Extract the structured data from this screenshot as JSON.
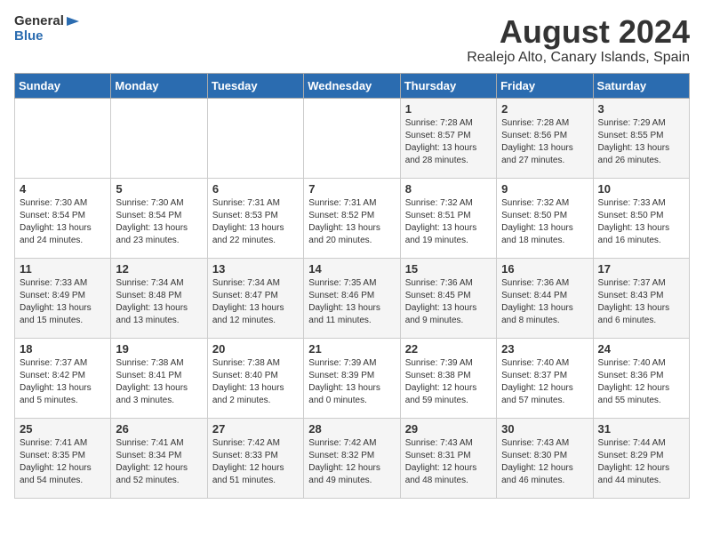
{
  "logo": {
    "general": "General",
    "blue": "Blue"
  },
  "title": {
    "month": "August 2024",
    "location": "Realejo Alto, Canary Islands, Spain"
  },
  "days_of_week": [
    "Sunday",
    "Monday",
    "Tuesday",
    "Wednesday",
    "Thursday",
    "Friday",
    "Saturday"
  ],
  "weeks": [
    [
      {
        "day": "",
        "info": ""
      },
      {
        "day": "",
        "info": ""
      },
      {
        "day": "",
        "info": ""
      },
      {
        "day": "",
        "info": ""
      },
      {
        "day": "1",
        "info": "Sunrise: 7:28 AM\nSunset: 8:57 PM\nDaylight: 13 hours\nand 28 minutes."
      },
      {
        "day": "2",
        "info": "Sunrise: 7:28 AM\nSunset: 8:56 PM\nDaylight: 13 hours\nand 27 minutes."
      },
      {
        "day": "3",
        "info": "Sunrise: 7:29 AM\nSunset: 8:55 PM\nDaylight: 13 hours\nand 26 minutes."
      }
    ],
    [
      {
        "day": "4",
        "info": "Sunrise: 7:30 AM\nSunset: 8:54 PM\nDaylight: 13 hours\nand 24 minutes."
      },
      {
        "day": "5",
        "info": "Sunrise: 7:30 AM\nSunset: 8:54 PM\nDaylight: 13 hours\nand 23 minutes."
      },
      {
        "day": "6",
        "info": "Sunrise: 7:31 AM\nSunset: 8:53 PM\nDaylight: 13 hours\nand 22 minutes."
      },
      {
        "day": "7",
        "info": "Sunrise: 7:31 AM\nSunset: 8:52 PM\nDaylight: 13 hours\nand 20 minutes."
      },
      {
        "day": "8",
        "info": "Sunrise: 7:32 AM\nSunset: 8:51 PM\nDaylight: 13 hours\nand 19 minutes."
      },
      {
        "day": "9",
        "info": "Sunrise: 7:32 AM\nSunset: 8:50 PM\nDaylight: 13 hours\nand 18 minutes."
      },
      {
        "day": "10",
        "info": "Sunrise: 7:33 AM\nSunset: 8:50 PM\nDaylight: 13 hours\nand 16 minutes."
      }
    ],
    [
      {
        "day": "11",
        "info": "Sunrise: 7:33 AM\nSunset: 8:49 PM\nDaylight: 13 hours\nand 15 minutes."
      },
      {
        "day": "12",
        "info": "Sunrise: 7:34 AM\nSunset: 8:48 PM\nDaylight: 13 hours\nand 13 minutes."
      },
      {
        "day": "13",
        "info": "Sunrise: 7:34 AM\nSunset: 8:47 PM\nDaylight: 13 hours\nand 12 minutes."
      },
      {
        "day": "14",
        "info": "Sunrise: 7:35 AM\nSunset: 8:46 PM\nDaylight: 13 hours\nand 11 minutes."
      },
      {
        "day": "15",
        "info": "Sunrise: 7:36 AM\nSunset: 8:45 PM\nDaylight: 13 hours\nand 9 minutes."
      },
      {
        "day": "16",
        "info": "Sunrise: 7:36 AM\nSunset: 8:44 PM\nDaylight: 13 hours\nand 8 minutes."
      },
      {
        "day": "17",
        "info": "Sunrise: 7:37 AM\nSunset: 8:43 PM\nDaylight: 13 hours\nand 6 minutes."
      }
    ],
    [
      {
        "day": "18",
        "info": "Sunrise: 7:37 AM\nSunset: 8:42 PM\nDaylight: 13 hours\nand 5 minutes."
      },
      {
        "day": "19",
        "info": "Sunrise: 7:38 AM\nSunset: 8:41 PM\nDaylight: 13 hours\nand 3 minutes."
      },
      {
        "day": "20",
        "info": "Sunrise: 7:38 AM\nSunset: 8:40 PM\nDaylight: 13 hours\nand 2 minutes."
      },
      {
        "day": "21",
        "info": "Sunrise: 7:39 AM\nSunset: 8:39 PM\nDaylight: 13 hours\nand 0 minutes."
      },
      {
        "day": "22",
        "info": "Sunrise: 7:39 AM\nSunset: 8:38 PM\nDaylight: 12 hours\nand 59 minutes."
      },
      {
        "day": "23",
        "info": "Sunrise: 7:40 AM\nSunset: 8:37 PM\nDaylight: 12 hours\nand 57 minutes."
      },
      {
        "day": "24",
        "info": "Sunrise: 7:40 AM\nSunset: 8:36 PM\nDaylight: 12 hours\nand 55 minutes."
      }
    ],
    [
      {
        "day": "25",
        "info": "Sunrise: 7:41 AM\nSunset: 8:35 PM\nDaylight: 12 hours\nand 54 minutes."
      },
      {
        "day": "26",
        "info": "Sunrise: 7:41 AM\nSunset: 8:34 PM\nDaylight: 12 hours\nand 52 minutes."
      },
      {
        "day": "27",
        "info": "Sunrise: 7:42 AM\nSunset: 8:33 PM\nDaylight: 12 hours\nand 51 minutes."
      },
      {
        "day": "28",
        "info": "Sunrise: 7:42 AM\nSunset: 8:32 PM\nDaylight: 12 hours\nand 49 minutes."
      },
      {
        "day": "29",
        "info": "Sunrise: 7:43 AM\nSunset: 8:31 PM\nDaylight: 12 hours\nand 48 minutes."
      },
      {
        "day": "30",
        "info": "Sunrise: 7:43 AM\nSunset: 8:30 PM\nDaylight: 12 hours\nand 46 minutes."
      },
      {
        "day": "31",
        "info": "Sunrise: 7:44 AM\nSunset: 8:29 PM\nDaylight: 12 hours\nand 44 minutes."
      }
    ]
  ]
}
